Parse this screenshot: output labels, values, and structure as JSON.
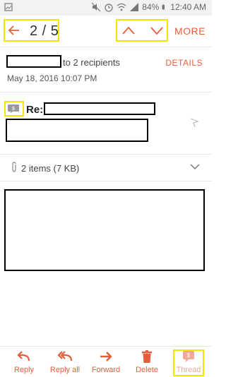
{
  "status_bar": {
    "battery": "84%",
    "time": "12:40 AM"
  },
  "toolbar": {
    "pager": "2 / 5",
    "more_label": "MORE"
  },
  "header": {
    "recipients_text": "to 2 recipients",
    "details_label": "DETAILS",
    "date": "May 18, 2016  10:07 PM"
  },
  "message": {
    "subject_prefix": "Re:"
  },
  "attachments": {
    "summary": "2 items (7 KB)"
  },
  "bottom_bar": {
    "reply": "Reply",
    "reply_all": "Reply all",
    "forward": "Forward",
    "delete": "Delete",
    "thread": "Thread"
  },
  "colors": {
    "accent": "#e0603b",
    "highlight": "#f5e400",
    "thread_muted": "#f0a898"
  }
}
